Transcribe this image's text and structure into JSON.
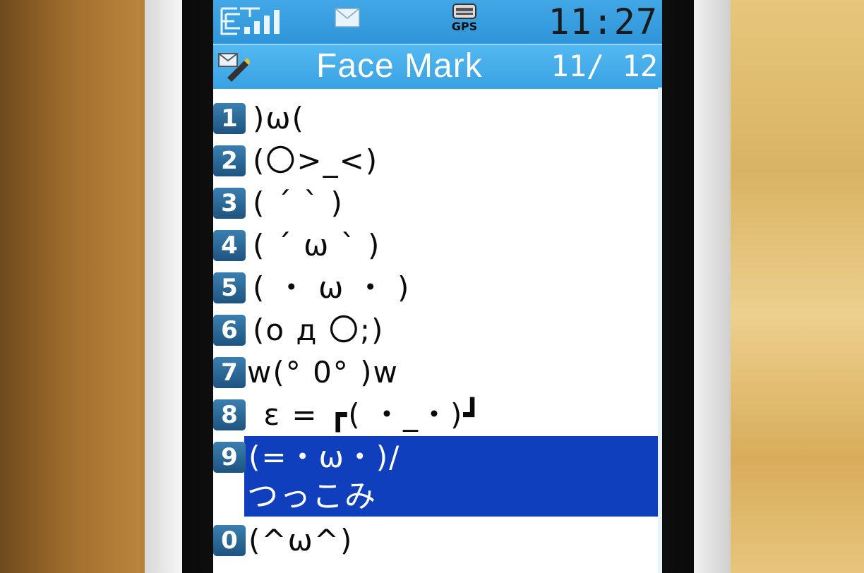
{
  "status_bar": {
    "clock": "11:27",
    "gps_label": "GPS"
  },
  "title_bar": {
    "title": "Face Mark",
    "page_indicator": "11/ 12"
  },
  "items": [
    {
      "key": "1",
      "face": ")ω("
    },
    {
      "key": "2",
      "face": "(〇>_<)"
    },
    {
      "key": "3",
      "face": "( ´ ` )"
    },
    {
      "key": "4",
      "face": "( ´ ω ` )"
    },
    {
      "key": "5",
      "face": "( ・ ω ・ )"
    },
    {
      "key": "6",
      "face": "(ο д 〇;)"
    },
    {
      "key": "7",
      "face": "w(° 0° )w"
    },
    {
      "key": "8",
      "face": " ε = ┏( ・_・)┛"
    },
    {
      "key": "9",
      "face": "(=・ω・)/",
      "subtitle": "つっこみ",
      "selected": true
    },
    {
      "key": "0",
      "face": "(^ω^)"
    }
  ],
  "colors": {
    "status_bar": "#2f95d8",
    "title_bar": "#3aa2e2",
    "selection": "#0f3fbd",
    "number_key": "#1e5480"
  }
}
